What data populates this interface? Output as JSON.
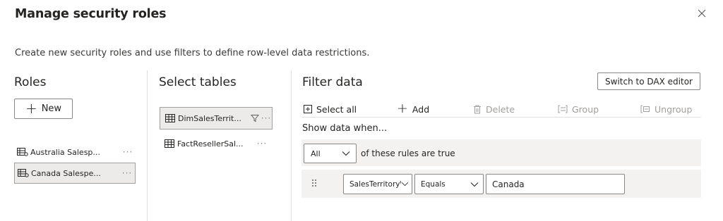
{
  "dialog": {
    "title": "Manage security roles",
    "subtitle": "Create new security roles and use filters to define row-level data restrictions.",
    "close_icon": "close-icon"
  },
  "roles": {
    "heading": "Roles",
    "new_label": "New",
    "items": [
      {
        "label": "Australia Salesp...",
        "more": "···",
        "selected": false
      },
      {
        "label": "Canada Salespe...",
        "more": "···",
        "selected": true
      }
    ]
  },
  "tables": {
    "heading": "Select tables",
    "items": [
      {
        "label": "DimSalesTerrit...",
        "more": "···",
        "selected": true,
        "filtered": true
      },
      {
        "label": "FactResellerSal...",
        "more": "···",
        "selected": false,
        "filtered": false
      }
    ]
  },
  "filter": {
    "heading": "Filter data",
    "dax_button": "Switch to DAX editor",
    "toolbar": {
      "select_all": "Select all",
      "add": "Add",
      "delete": "Delete",
      "group": "Group",
      "ungroup": "Ungroup"
    },
    "show_when": "Show data when...",
    "match_mode": "All",
    "rules_text": "of these rules are true",
    "rule": {
      "column": "SalesTerritory\\",
      "operator": "Equals",
      "value": "Canada"
    }
  },
  "colors": {
    "border": "#8a8886",
    "selected_bg": "#edebe9",
    "panel_bg": "#f3f2f1",
    "disabled_text": "#a19f9d"
  }
}
